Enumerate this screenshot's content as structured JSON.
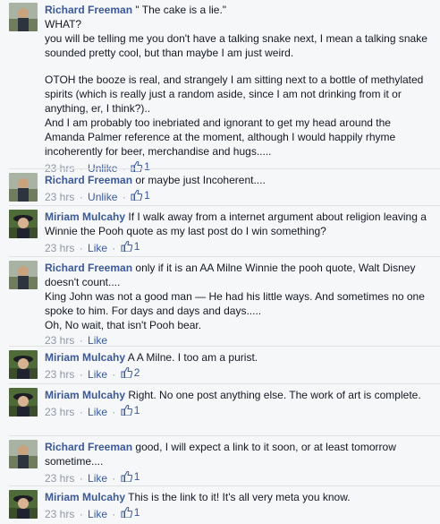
{
  "comments": [
    {
      "author": "Richard Freeman",
      "avatar_icon": "profile-photo-richard",
      "lines": [
        "\" The cake is a lie.\"",
        "WHAT?",
        "you will be telling me you don't have a talking snake next, I mean a talking snake sounded pretty cool, but than maybe I am just weird.",
        "",
        "OTOH the booze is real, and strangely I am sitting next to a bottle of methylated spirits (which is really just a random aside, since I am not drinking from it or anything, er, I think?)..",
        "And I am probably too inebriated and ignorant to get my head around the Amanda Palmer reference at the moment, although I would happily rhyme incoherently for beer, merchandise and hugs....."
      ],
      "time": "23 hrs",
      "action": "Unlike",
      "like_count": "1"
    },
    {
      "author": "Richard Freeman",
      "avatar_icon": "profile-photo-richard",
      "lines": [
        "or maybe just Incoherent...."
      ],
      "time": "23 hrs",
      "action": "Unlike",
      "like_count": "1"
    },
    {
      "author": "Miriam Mulcahy",
      "avatar_icon": "profile-photo-miriam",
      "lines": [
        "If I walk away from a internet argument about religion leaving a Winnie the Pooh quote as my last post do I win something?"
      ],
      "time": "23 hrs",
      "action": "Like",
      "like_count": "1"
    },
    {
      "author": "Richard Freeman",
      "avatar_icon": "profile-photo-richard",
      "lines": [
        "only if it is an AA Milne Winnie the pooh quote, Walt Disney doesn't count....",
        "King John was not a good man — He had his little ways. And sometimes no one spoke to him. For days and days and days.....",
        "Oh, No wait, that isn't Pooh bear."
      ],
      "time": "23 hrs",
      "action": "Like",
      "like_count": ""
    },
    {
      "author": "Miriam Mulcahy",
      "avatar_icon": "profile-photo-miriam",
      "lines": [
        "A A Milne. I too am a purist."
      ],
      "time": "23 hrs",
      "action": "Like",
      "like_count": "2"
    },
    {
      "author": "Miriam Mulcahy",
      "avatar_icon": "profile-photo-miriam",
      "lines": [
        "Right. No one post anything else. The work of art is complete."
      ],
      "time": "23 hrs",
      "action": "Like",
      "like_count": "1"
    },
    {
      "author": "Richard Freeman",
      "avatar_icon": "profile-photo-richard",
      "lines": [
        "good, I will expect a link to it soon, or at least tomorrow sometime...."
      ],
      "time": "23 hrs",
      "action": "Like",
      "like_count": "1"
    },
    {
      "author": "Miriam Mulcahy",
      "avatar_icon": "profile-photo-miriam",
      "lines": [
        "This is the link to it! It's all very meta you know."
      ],
      "time": "23 hrs",
      "action": "Like",
      "like_count": "1"
    }
  ]
}
